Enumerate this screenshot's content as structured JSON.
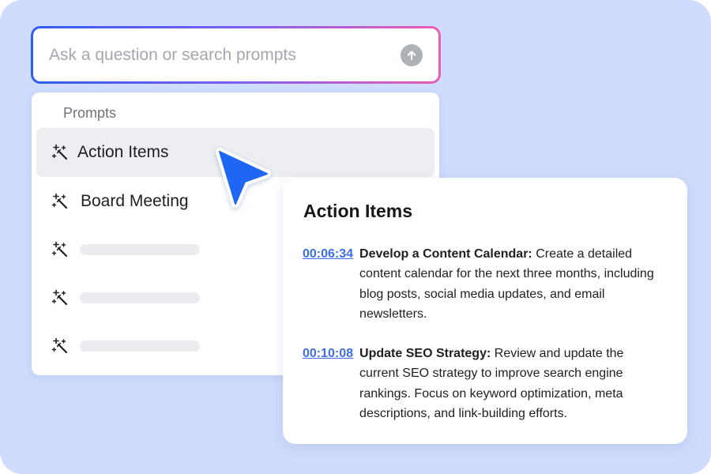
{
  "search": {
    "placeholder": "Ask a question or search prompts",
    "send_icon": "arrow-up-icon"
  },
  "dropdown": {
    "section_label": "Prompts",
    "items": [
      {
        "label": "Action Items",
        "icon": "magic-wand-icon",
        "active": true
      },
      {
        "label": "Board Meeting",
        "icon": "magic-wand-icon"
      },
      {
        "label": "",
        "icon": "magic-wand-icon",
        "placeholder_skeleton": true
      },
      {
        "label": "",
        "icon": "magic-wand-icon",
        "placeholder_skeleton": true
      },
      {
        "label": "",
        "icon": "magic-wand-icon",
        "placeholder_skeleton": true
      }
    ]
  },
  "card": {
    "title": "Action Items",
    "entries": [
      {
        "timestamp": "00:06:34",
        "heading": "Develop a Content Calendar:",
        "text": " Create a detailed content calendar for the next three months, including blog posts, social media updates, and email newsletters."
      },
      {
        "timestamp": "00:10:08",
        "heading": "Update SEO Strategy:",
        "text": " Review and update the current SEO strategy to improve search engine rankings. Focus on keyword optimization, meta descriptions, and link-building efforts."
      }
    ]
  },
  "colors": {
    "background": "#cfdcfd",
    "gradient_start": "#2f5df1",
    "gradient_end": "#ef5db4",
    "link": "#3d6ee6",
    "cursor": "#1f67f2"
  }
}
